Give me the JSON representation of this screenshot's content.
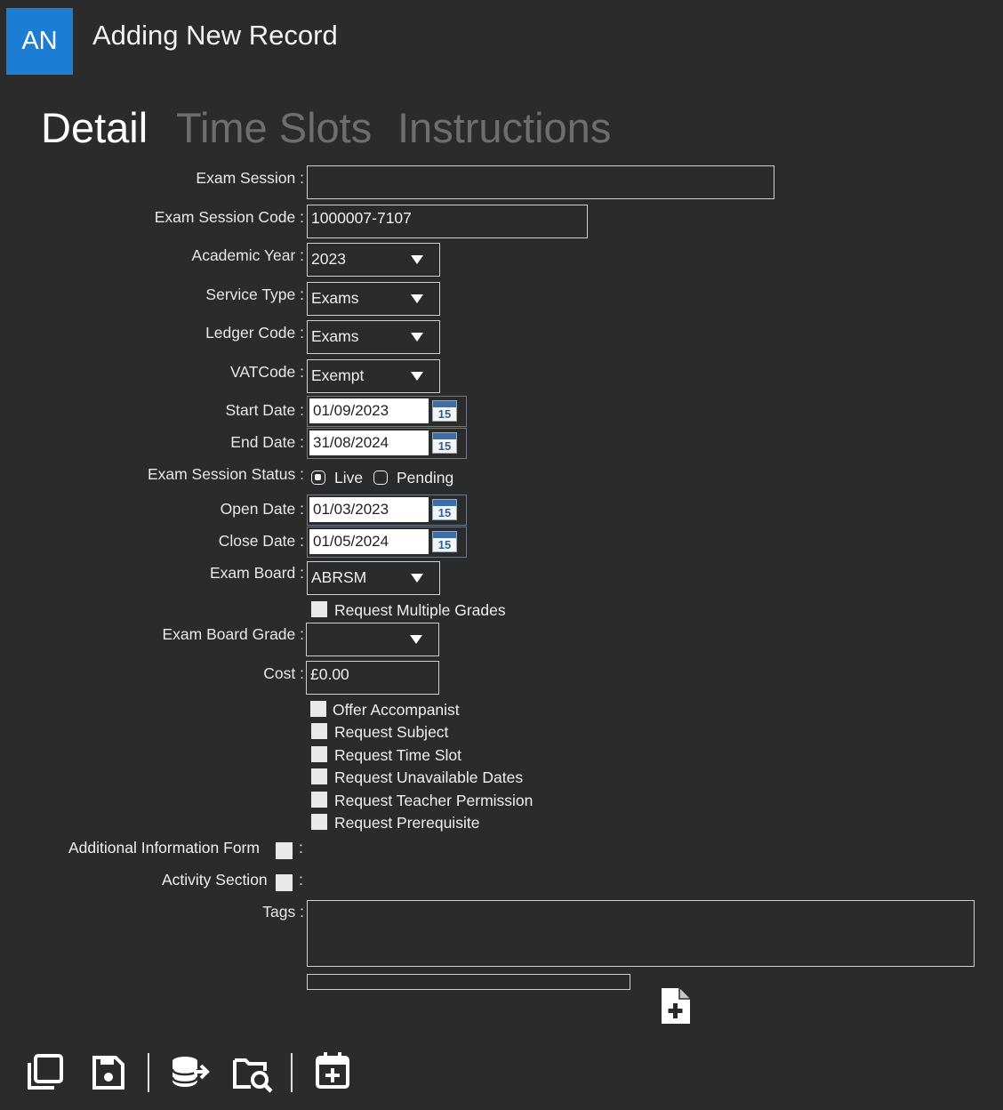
{
  "header": {
    "avatar_initials": "AN",
    "title": "Adding New Record"
  },
  "tabs": [
    {
      "label": "Detail",
      "active": true
    },
    {
      "label": "Time Slots",
      "active": false
    },
    {
      "label": "Instructions",
      "active": false
    }
  ],
  "form": {
    "exam_session": {
      "label": "Exam Session :",
      "value": ""
    },
    "exam_session_code": {
      "label": "Exam Session Code :",
      "value": "1000007-7107"
    },
    "academic_year": {
      "label": "Academic Year :",
      "value": "2023"
    },
    "service_type": {
      "label": "Service Type :",
      "value": "Exams"
    },
    "ledger_code": {
      "label": "Ledger Code :",
      "value": "Exams"
    },
    "vat_code": {
      "label": "VATCode :",
      "value": "Exempt"
    },
    "start_date": {
      "label": "Start Date :",
      "value": "01/09/2023",
      "calendar_day": "15"
    },
    "end_date": {
      "label": "End Date :",
      "value": "31/08/2024",
      "calendar_day": "15"
    },
    "status": {
      "label": "Exam Session Status :",
      "options": [
        {
          "label": "Live",
          "selected": true
        },
        {
          "label": "Pending",
          "selected": false
        }
      ]
    },
    "open_date": {
      "label": "Open Date :",
      "value": "01/03/2023",
      "calendar_day": "15"
    },
    "close_date": {
      "label": "Close Date :",
      "value": "01/05/2024",
      "calendar_day": "15"
    },
    "exam_board": {
      "label": "Exam Board :",
      "value": "ABRSM"
    },
    "request_multiple_grades": {
      "label": "Request Multiple Grades",
      "checked": false
    },
    "exam_board_grade": {
      "label": "Exam Board Grade :",
      "value": ""
    },
    "cost": {
      "label": "Cost :",
      "value": "£0.00"
    },
    "options": [
      {
        "label": "Offer Accompanist",
        "checked": false
      },
      {
        "label": "Request Subject",
        "checked": false
      },
      {
        "label": "Request Time Slot",
        "checked": false
      },
      {
        "label": "Request Unavailable Dates",
        "checked": false
      },
      {
        "label": "Request Teacher Permission",
        "checked": false
      },
      {
        "label": "Request Prerequisite",
        "checked": false
      }
    ],
    "additional_information_form": {
      "label": "Additional Information Form",
      "colon": ":",
      "checked": false
    },
    "activity_section": {
      "label": "Activity Section",
      "colon": ":",
      "checked": false
    },
    "tags": {
      "label": "Tags :",
      "value": ""
    }
  },
  "toolbar": {
    "icons": [
      "copy-icon",
      "save-icon",
      "database-export-icon",
      "folder-search-icon",
      "calendar-add-icon"
    ],
    "tag_add_icon": "file-add-icon"
  },
  "colors": {
    "background": "#2b2b2b",
    "avatar": "#1c7dd4",
    "inactive_tab": "#6e6e6e",
    "text": "#ffffff"
  }
}
